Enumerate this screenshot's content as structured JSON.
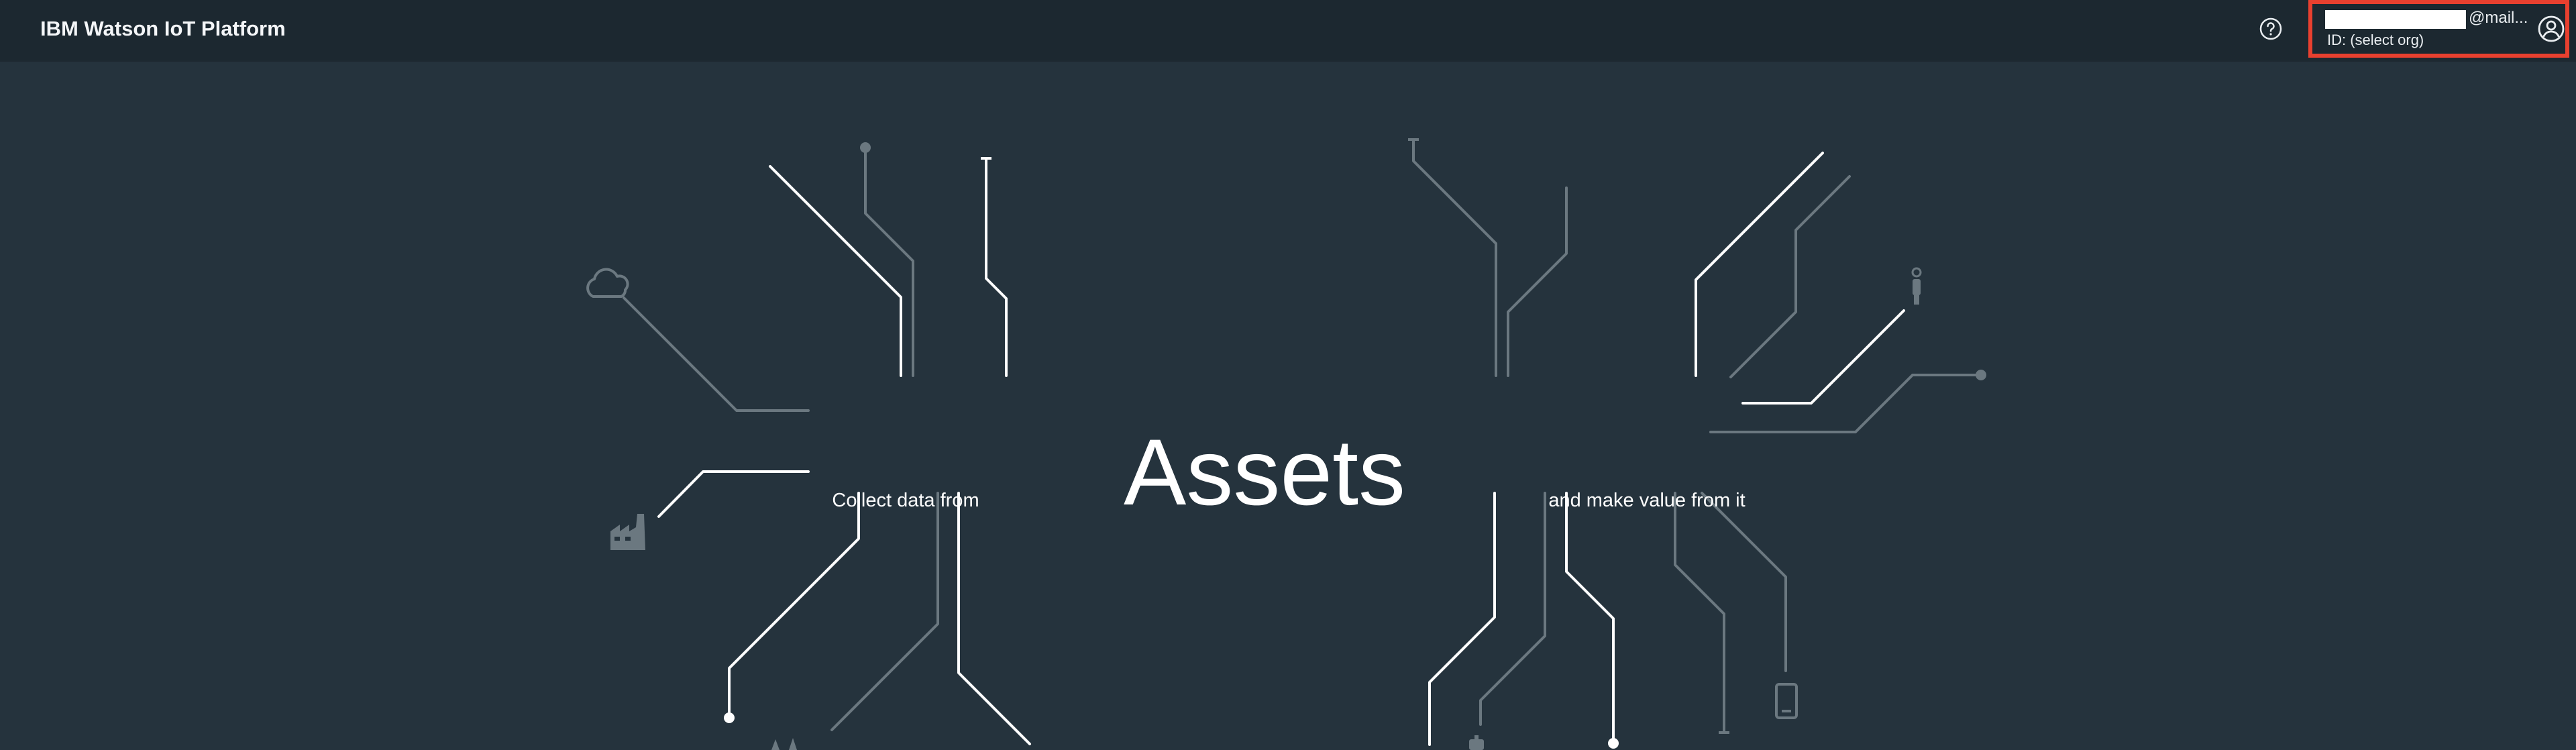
{
  "header": {
    "title": "IBM Watson IoT Platform",
    "help_icon": "help-circle-icon",
    "account": {
      "email_domain": "@mail...",
      "org_id": "ID: (select org)",
      "avatar_icon": "user-avatar-icon",
      "highlight_color": "#e8402f"
    }
  },
  "hero": {
    "title": "Assets",
    "left_caption": "Collect data from",
    "right_caption": "and make value from it",
    "icons": [
      "cloud-icon",
      "factory-icon",
      "person-icon",
      "mobile-phone-icon",
      "power-plant-icon",
      "robot-icon"
    ]
  },
  "colors": {
    "background": "#25333d",
    "header_background": "#1c2830",
    "line_bright": "#ffffff",
    "line_dim": "#6b7880"
  }
}
